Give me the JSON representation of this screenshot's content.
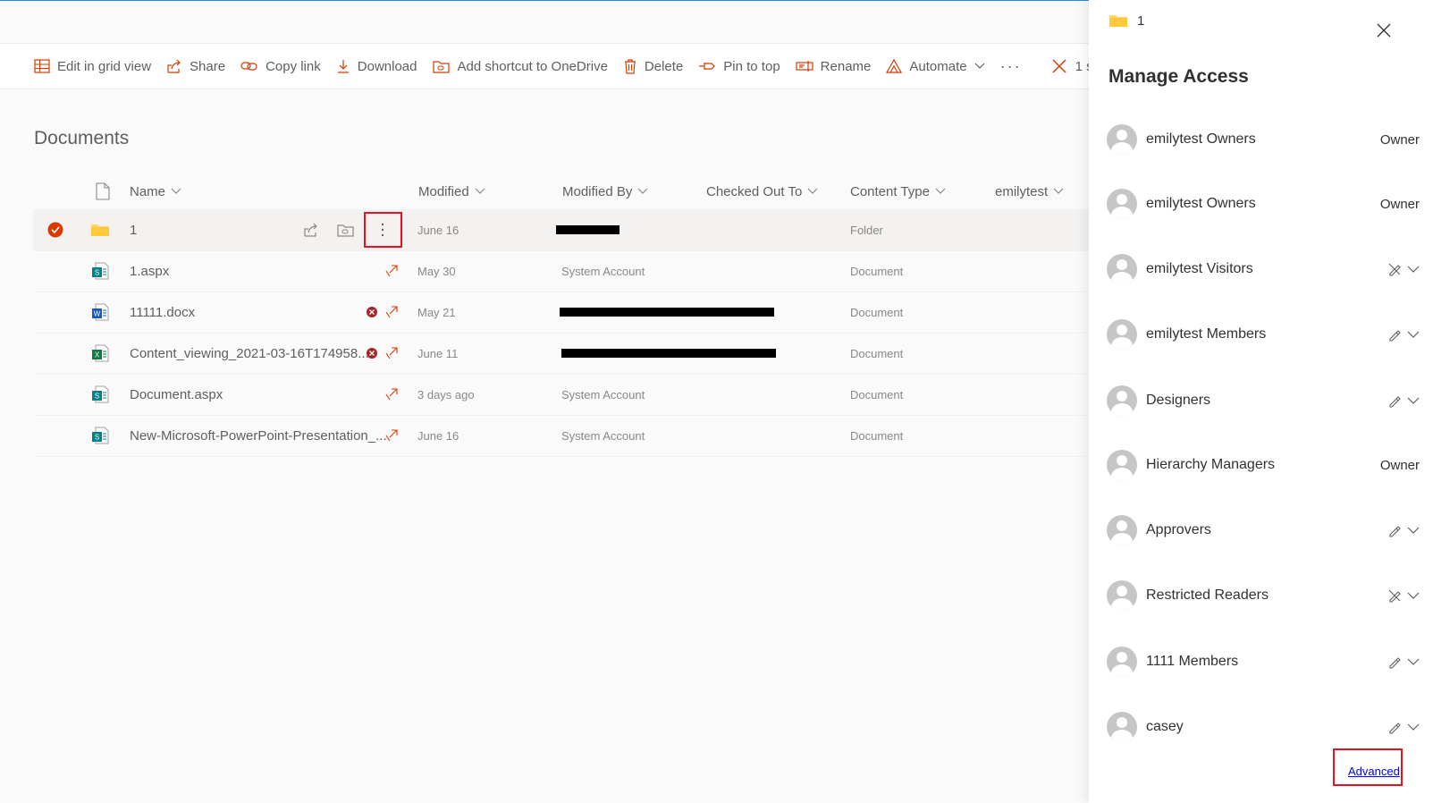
{
  "commandbar": {
    "items": [
      {
        "label": "Edit in grid view",
        "icon": "grid-icon"
      },
      {
        "label": "Share",
        "icon": "share-icon"
      },
      {
        "label": "Copy link",
        "icon": "link-icon"
      },
      {
        "label": "Download",
        "icon": "download-icon"
      },
      {
        "label": "Add shortcut to OneDrive",
        "icon": "shortcut-icon"
      },
      {
        "label": "Delete",
        "icon": "trash-icon"
      },
      {
        "label": "Pin to top",
        "icon": "pin-icon"
      },
      {
        "label": "Rename",
        "icon": "rename-icon"
      },
      {
        "label": "Automate",
        "icon": "automate-icon"
      }
    ],
    "more": "···",
    "selected_text": "1 s"
  },
  "library": {
    "title": "Documents",
    "columns": [
      "Name",
      "Modified",
      "Modified By",
      "Checked Out To",
      "Content Type",
      "emilytest"
    ],
    "rows": [
      {
        "name": "1",
        "type": "folder",
        "modified": "June 16",
        "modified_by": "",
        "content_type": "Folder",
        "selected": true
      },
      {
        "name": "1.aspx",
        "type": "aspx",
        "modified": "May 30",
        "modified_by": "System Account",
        "content_type": "Document"
      },
      {
        "name": "11111.docx",
        "type": "docx",
        "modified": "May 21",
        "modified_by": "",
        "content_type": "Document"
      },
      {
        "name": "Content_viewing_2021-03-16T174958....",
        "type": "xlsx",
        "modified": "June 11",
        "modified_by": "",
        "content_type": "Document"
      },
      {
        "name": "Document.aspx",
        "type": "aspx",
        "modified": "3 days ago",
        "modified_by": "System Account",
        "content_type": "Document"
      },
      {
        "name": "New-Microsoft-PowerPoint-Presentation_...",
        "type": "aspx",
        "modified": "June 16",
        "modified_by": "System Account",
        "content_type": "Document"
      }
    ]
  },
  "panel": {
    "folder_name": "1",
    "title": "Manage Access",
    "entries": [
      {
        "name": "emilytest Owners",
        "right": "Owner",
        "right_type": "text"
      },
      {
        "name": "emilytest Owners",
        "right": "Owner",
        "right_type": "text"
      },
      {
        "name": "emilytest Visitors",
        "right": "",
        "right_type": "no-edit"
      },
      {
        "name": "emilytest Members",
        "right": "",
        "right_type": "edit"
      },
      {
        "name": "Designers",
        "right": "",
        "right_type": "edit"
      },
      {
        "name": "Hierarchy Managers",
        "right": "Owner",
        "right_type": "text"
      },
      {
        "name": "Approvers",
        "right": "",
        "right_type": "edit"
      },
      {
        "name": "Restricted Readers",
        "right": "",
        "right_type": "no-edit"
      },
      {
        "name": "1111 Members",
        "right": "",
        "right_type": "edit"
      },
      {
        "name": "casey",
        "right": "",
        "right_type": "edit"
      }
    ],
    "advanced_label": "Advanced"
  },
  "colors": {
    "accent": "#d83b01",
    "link": "#0000ee",
    "highlight_box": "#e81123"
  }
}
